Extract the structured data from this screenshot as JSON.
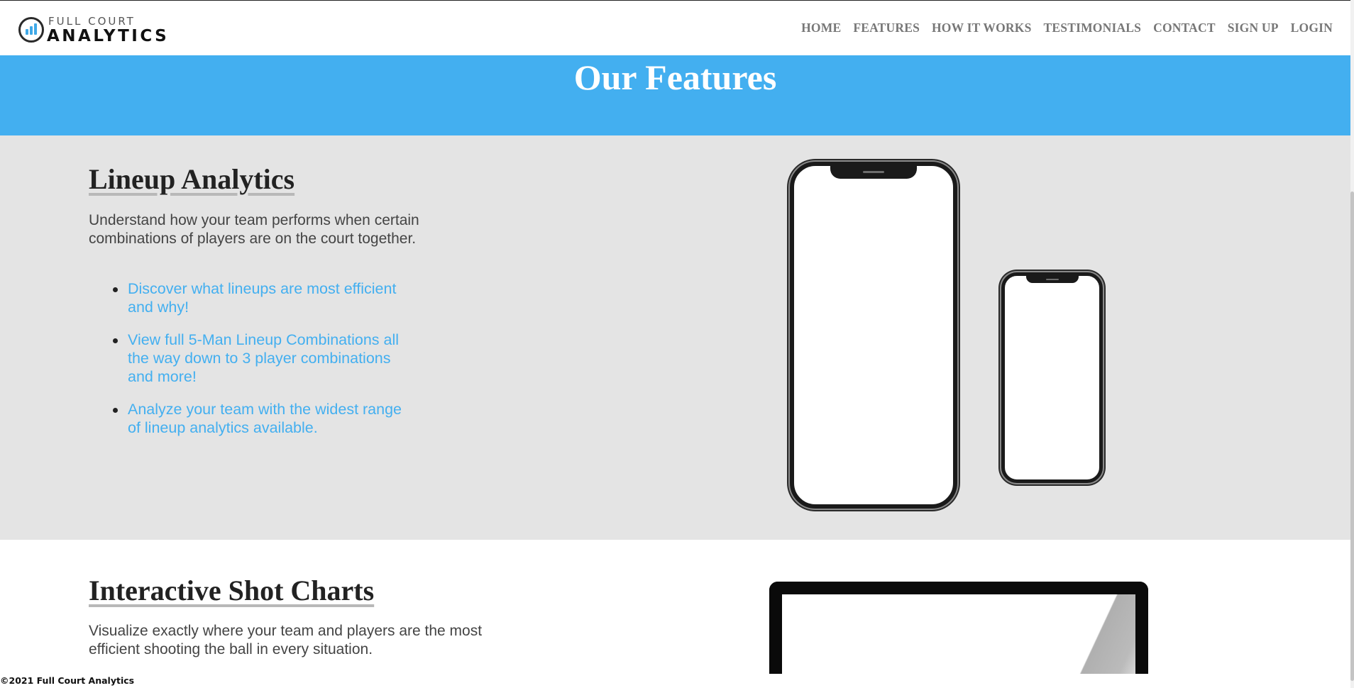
{
  "header": {
    "logo": {
      "line1": "FULL COURT",
      "line2": "ANALYTICS"
    },
    "nav": [
      "HOME",
      "FEATURES",
      "HOW IT WORKS",
      "TESTIMONIALS",
      "CONTACT",
      "SIGN UP",
      "LOGIN"
    ]
  },
  "hero": {
    "title": "Our Features"
  },
  "features": [
    {
      "title": "Lineup Analytics",
      "description": "Understand how your team performs when certain combinations of players are on the court together.",
      "bullets": [
        "Discover what lineups are most efficient and why!",
        "View full 5-Man Lineup Combinations all the way down to 3 player combinations and more!",
        "Analyze your team with the widest range of lineup analytics available."
      ]
    },
    {
      "title": "Interactive Shot Charts",
      "description": "Visualize exactly where your team and players are the most efficient shooting the ball in every situation."
    }
  ],
  "footer": {
    "copyright": "©2021 Full Court Analytics"
  },
  "colors": {
    "accent": "#43aff0",
    "section_bg": "#e4e4e4",
    "nav_text": "#777777"
  },
  "icons": {
    "logo": "bar-chart-circle-icon"
  }
}
